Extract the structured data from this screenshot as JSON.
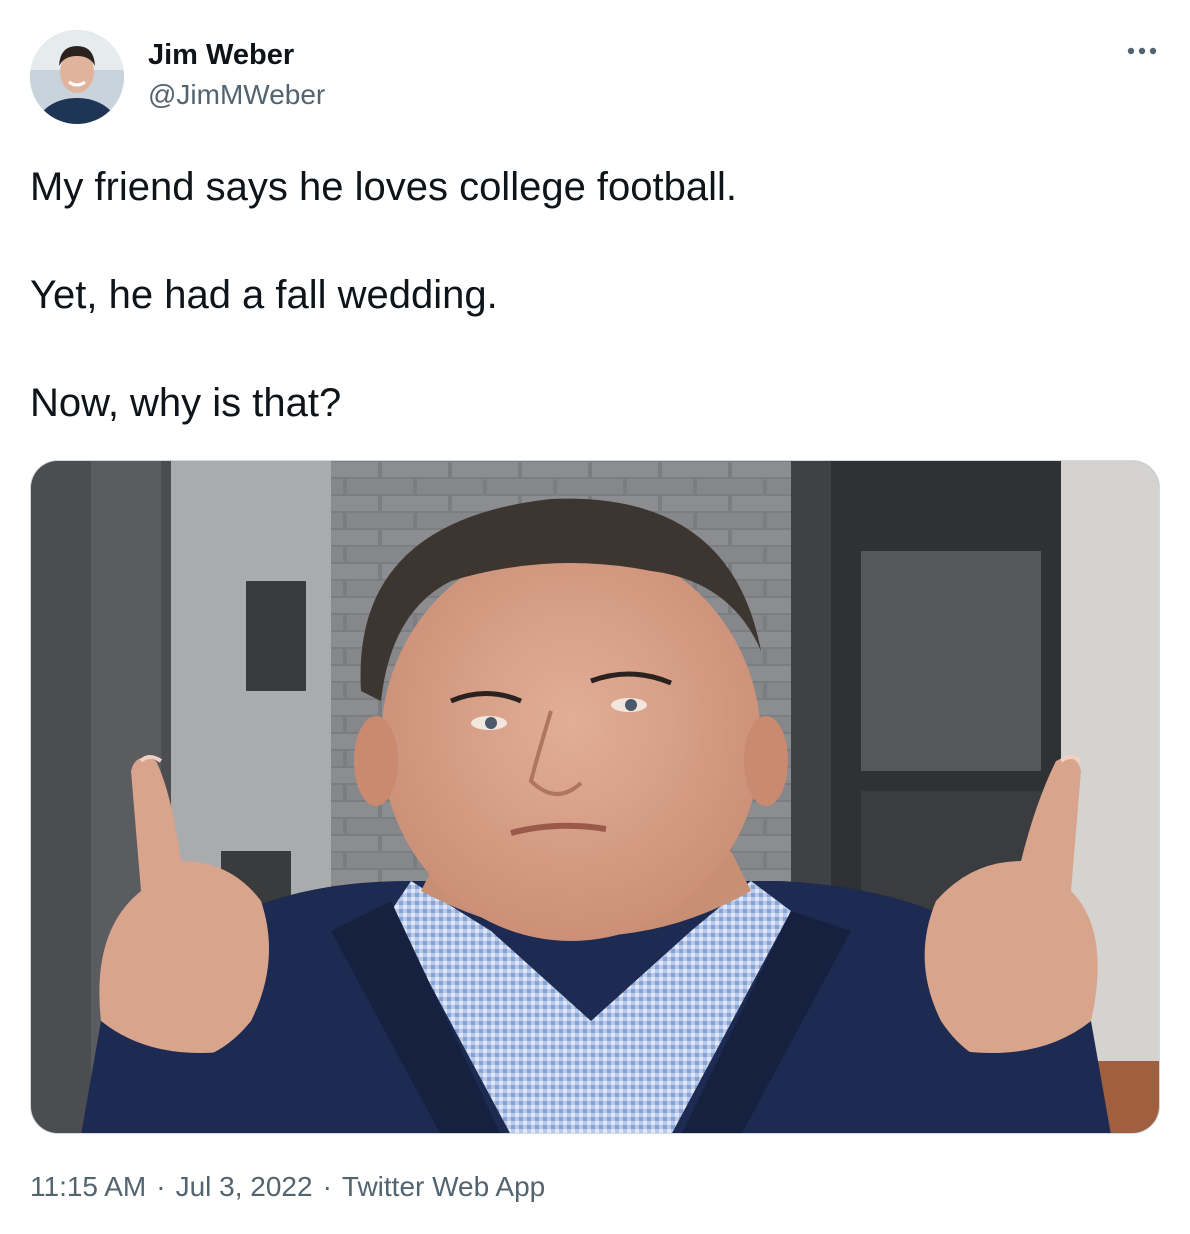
{
  "author": {
    "name": "Jim Weber",
    "handle": "@JimMWeber"
  },
  "more_icon": "more-horizontal-icon",
  "tweet": {
    "lines": [
      "My friend says he loves college football.",
      "Yet, he had a fall wedding.",
      "Now, why is that?"
    ]
  },
  "meta": {
    "time": "11:15 AM",
    "date": "Jul 3, 2022",
    "source": "Twitter Web App",
    "separator": "·"
  },
  "colors": {
    "text": "#0f1419",
    "secondary": "#536471",
    "border": "#cfd9de",
    "suit": "#1d2a52",
    "shirt": "#a9bde0",
    "skin": "#d9a48c"
  }
}
